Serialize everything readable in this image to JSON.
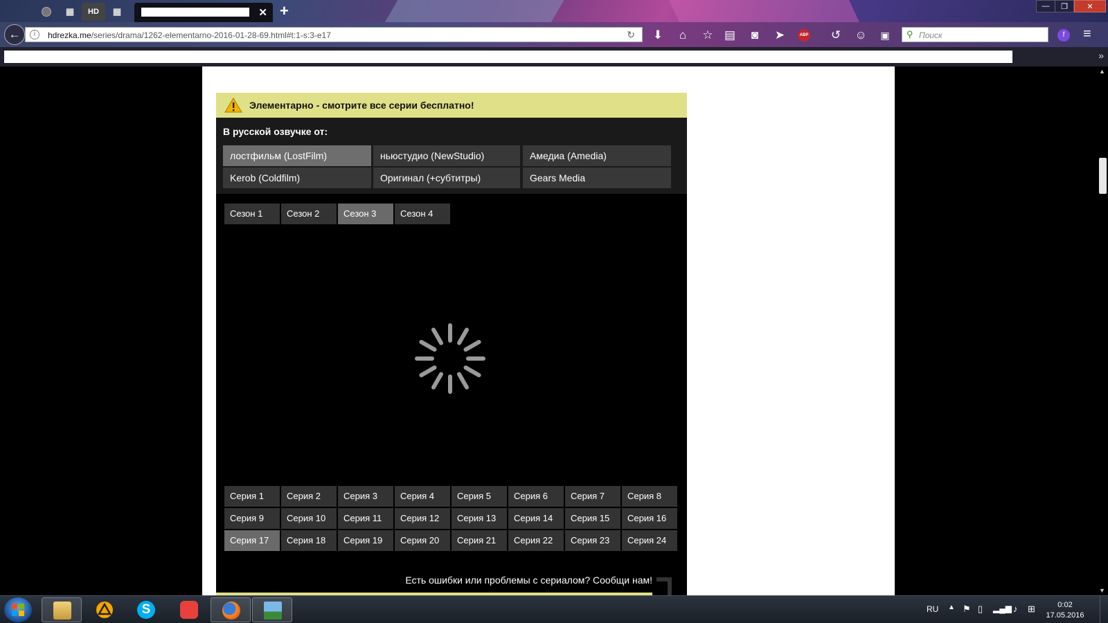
{
  "browser": {
    "pinned_tabs": [
      "",
      "",
      "",
      "HD",
      ""
    ],
    "new_tab_label": "+",
    "close_tab_label": "✕",
    "window_controls": [
      "—",
      "❐",
      "✕"
    ],
    "url_host": "hdrezka.me",
    "url_path": "/series/drama/1262-elementarno-2016-01-28-69.html#t:1-s:3-e17",
    "search_placeholder": "Поиск",
    "abp_label": "ABP",
    "bookmarks_chevron": "»"
  },
  "page": {
    "notice_text": "Элементарно - смотрите все серии бесплатно!",
    "voice_heading": "В русской озвучке от:",
    "voices": [
      "лостфильм (LostFilm)",
      "ньюстудио (NewStudio)",
      "Амедиа (Amedia)",
      "Kerob (Coldfilm)",
      "Оригинал (+субтитры)",
      "Gears Media"
    ],
    "selected_voice": "лостфильм (LostFilm)",
    "seasons": [
      "Сезон 1",
      "Сезон 2",
      "Сезон 3",
      "Сезон 4"
    ],
    "selected_season": "Сезон 3",
    "episodes": [
      "Серия 1",
      "Серия 2",
      "Серия 3",
      "Серия 4",
      "Серия 5",
      "Серия 6",
      "Серия 7",
      "Серия 8",
      "Серия 9",
      "Серия 10",
      "Серия 11",
      "Серия 12",
      "Серия 13",
      "Серия 14",
      "Серия 15",
      "Серия 16",
      "Серия 17",
      "Серия 18",
      "Серия 19",
      "Серия 20",
      "Серия 21",
      "Серия 22",
      "Серия 23",
      "Серия 24"
    ],
    "selected_episode": "Серия 17",
    "report_text": "Есть ошибки или проблемы с сериалом? Сообщи нам!"
  },
  "taskbar": {
    "apps": [
      "file-explorer",
      "aimp",
      "skype",
      "screenshot-tool",
      "firefox",
      "image-viewer"
    ],
    "language": "RU",
    "time": "0:02",
    "date": "17.05.2016"
  },
  "colors": {
    "notice_bg": "#e0e088",
    "player_bg": "#000000",
    "voice_bg": "#383838",
    "selected_bg": "#6a6a6a"
  }
}
